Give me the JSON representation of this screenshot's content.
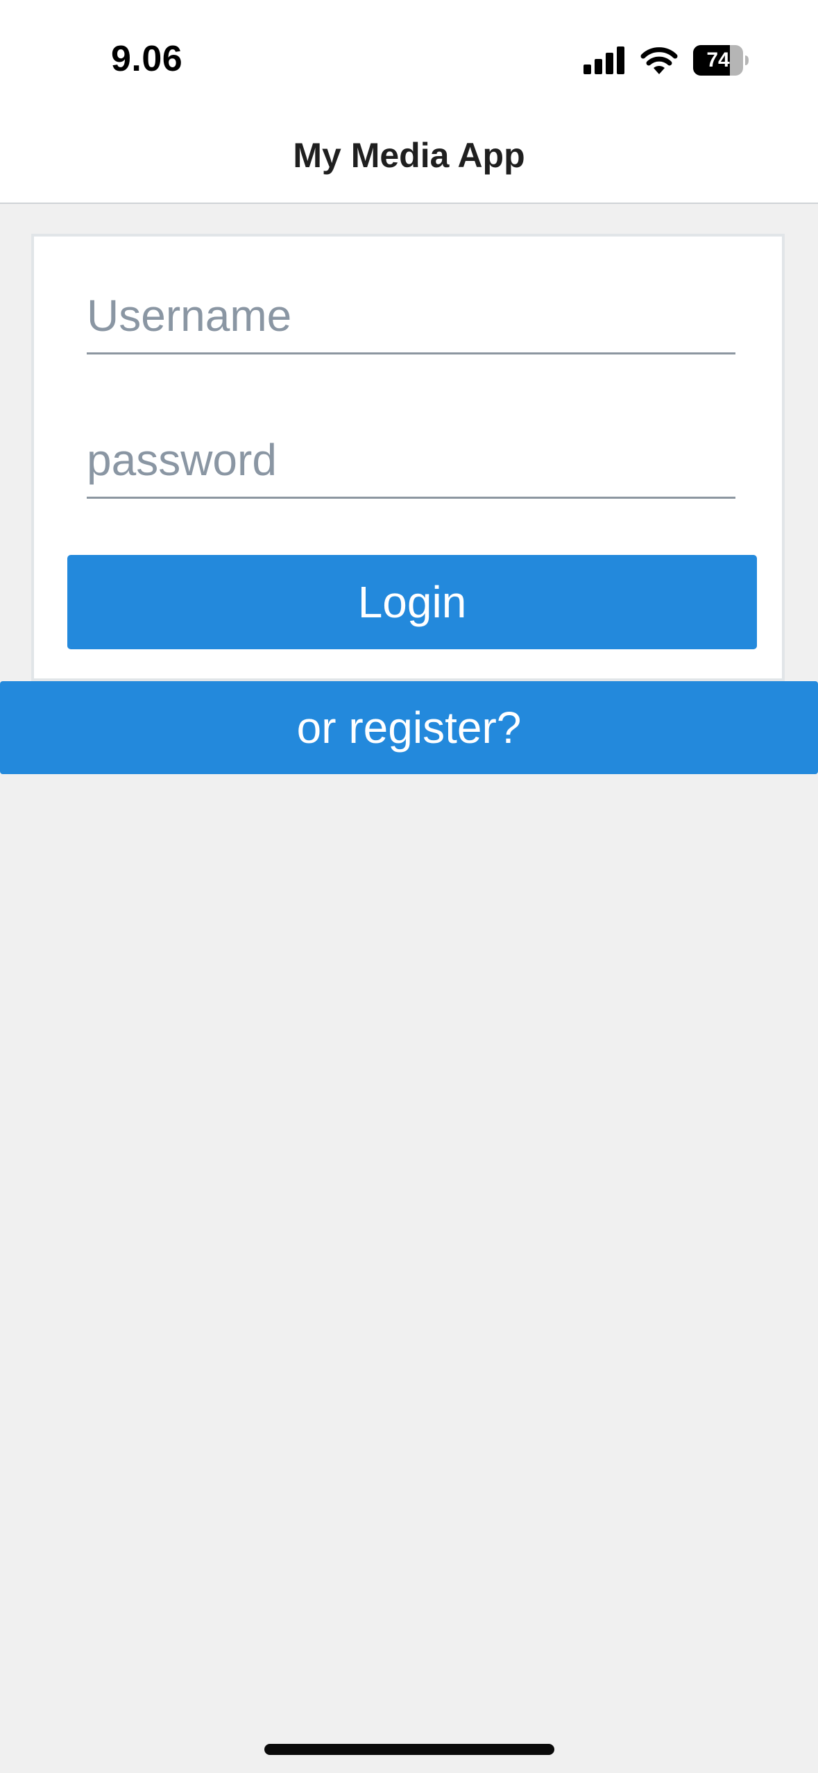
{
  "status_bar": {
    "time": "9.06",
    "battery_level": "74",
    "icons": [
      "signal-icon",
      "wifi-icon",
      "battery-icon"
    ]
  },
  "nav": {
    "title": "My Media App"
  },
  "login_form": {
    "username_placeholder": "Username",
    "username_value": "",
    "password_placeholder": "password",
    "password_value": "",
    "login_label": "Login"
  },
  "register": {
    "label": "or register?"
  },
  "colors": {
    "accent": "#2389dc",
    "background": "#f0f0f0",
    "card": "#ffffff",
    "placeholder": "#8a96a3"
  }
}
